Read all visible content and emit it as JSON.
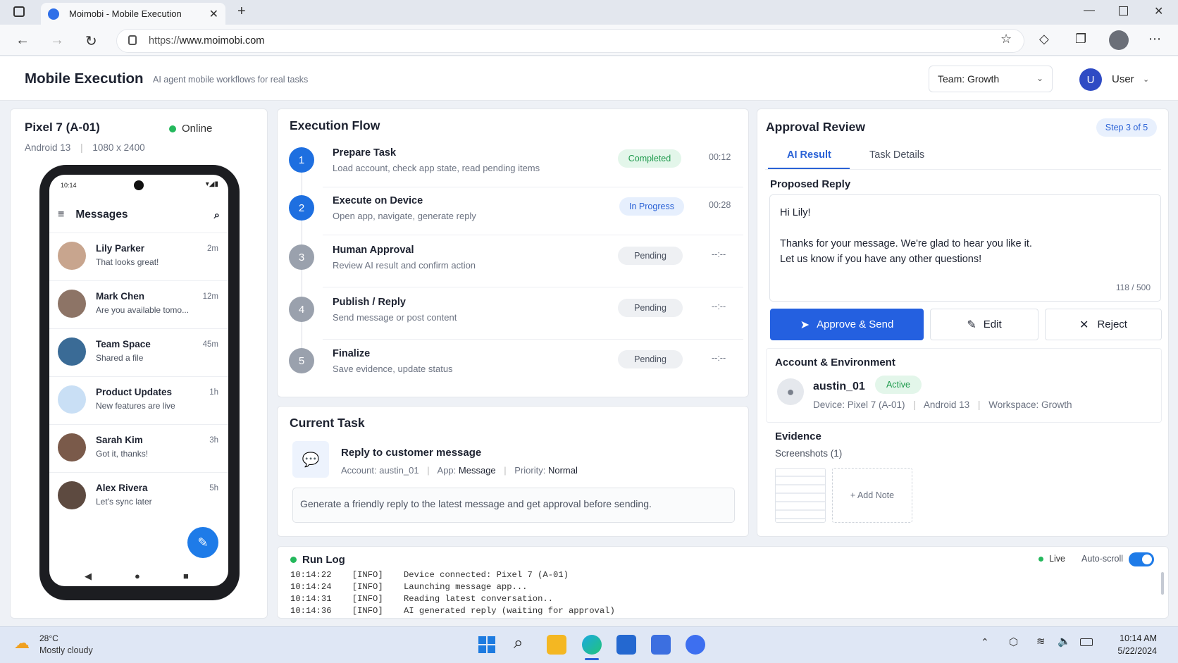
{
  "browser": {
    "tab_title": "Moimobi - Mobile Execution",
    "url_prefix": "https://",
    "url_domain": "www.moimobi.com"
  },
  "app": {
    "title": "Mobile Execution",
    "subtitle": "AI agent mobile workflows for real tasks",
    "team_select": "Team: Growth",
    "user_initial": "U",
    "user_name": "User"
  },
  "device": {
    "name": "Pixel 7 (A-01)",
    "status": "Online",
    "os": "Android 13",
    "resolution": "1080 x 2400",
    "phone_time": "10:14",
    "messages_title": "Messages",
    "conversations": [
      {
        "name": "Lily Parker",
        "text": "That looks great!",
        "time": "2m"
      },
      {
        "name": "Mark Chen",
        "text": "Are you available tomo...",
        "time": "12m"
      },
      {
        "name": "Team Space",
        "text": "Shared a file",
        "time": "45m"
      },
      {
        "name": "Product Updates",
        "text": "New features are live",
        "time": "1h"
      },
      {
        "name": "Sarah Kim",
        "text": "Got it, thanks!",
        "time": "3h"
      },
      {
        "name": "Alex Rivera",
        "text": "Let's sync later",
        "time": "5h"
      }
    ]
  },
  "execution_flow": {
    "title": "Execution Flow",
    "steps": [
      {
        "num": "1",
        "name": "Prepare Task",
        "desc": "Load account, check app state, read pending items",
        "status": "Completed",
        "time": "00:12"
      },
      {
        "num": "2",
        "name": "Execute on Device",
        "desc": "Open app, navigate, generate reply",
        "status": "In Progress",
        "time": "00:28"
      },
      {
        "num": "3",
        "name": "Human Approval",
        "desc": "Review AI result and confirm action",
        "status": "Pending",
        "time": "--:--"
      },
      {
        "num": "4",
        "name": "Publish / Reply",
        "desc": "Send message or post content",
        "status": "Pending",
        "time": "--:--"
      },
      {
        "num": "5",
        "name": "Finalize",
        "desc": "Save evidence, update status",
        "status": "Pending",
        "time": "--:--"
      }
    ]
  },
  "current_task": {
    "title": "Current Task",
    "name": "Reply to customer message",
    "account_label": "Account:",
    "account": "austin_01",
    "app_label": "App:",
    "app": "Message",
    "priority_label": "Priority:",
    "priority": "Normal",
    "description": "Generate a friendly reply to the latest message and get approval before sending."
  },
  "approval": {
    "title": "Approval Review",
    "step": "Step 3 of 5",
    "tab_active": "AI Result",
    "tab_other": "Task Details",
    "proposed_label": "Proposed Reply",
    "reply_line1": "Hi Lily!",
    "reply_line2": "Thanks for your message. We're glad to hear you like it.",
    "reply_line3": "Let us know if you have any other questions!",
    "char_count": "118 / 500",
    "approve_label": "Approve & Send",
    "edit_label": "Edit",
    "reject_label": "Reject",
    "account_section": "Account & Environment",
    "account_name": "austin_01",
    "account_status": "Active",
    "device_info": "Device: Pixel 7 (A-01)",
    "android": "Android 13",
    "workspace": "Workspace: Growth",
    "evidence_title": "Evidence",
    "screenshots": "Screenshots (1)",
    "add_note": "+ Add Note"
  },
  "run_log": {
    "title": "Run Log",
    "live": "Live",
    "autoscroll": "Auto-scroll",
    "entries": [
      {
        "time": "10:14:22",
        "level": "[INFO]",
        "msg": "Device connected: Pixel 7 (A-01)"
      },
      {
        "time": "10:14:24",
        "level": "[INFO]",
        "msg": "Launching message app..."
      },
      {
        "time": "10:14:31",
        "level": "[INFO]",
        "msg": "Reading latest conversation.."
      },
      {
        "time": "10:14:36",
        "level": "[INFO]",
        "msg": "AI generated reply (waiting for approval)"
      }
    ]
  },
  "taskbar": {
    "temp": "28°C",
    "weather": "Mostly cloudy",
    "time": "10:14 AM",
    "date": "5/22/2024"
  },
  "colors": {
    "primary": "#2563eb",
    "success": "#24b85c",
    "pending": "#9aa1ad"
  }
}
